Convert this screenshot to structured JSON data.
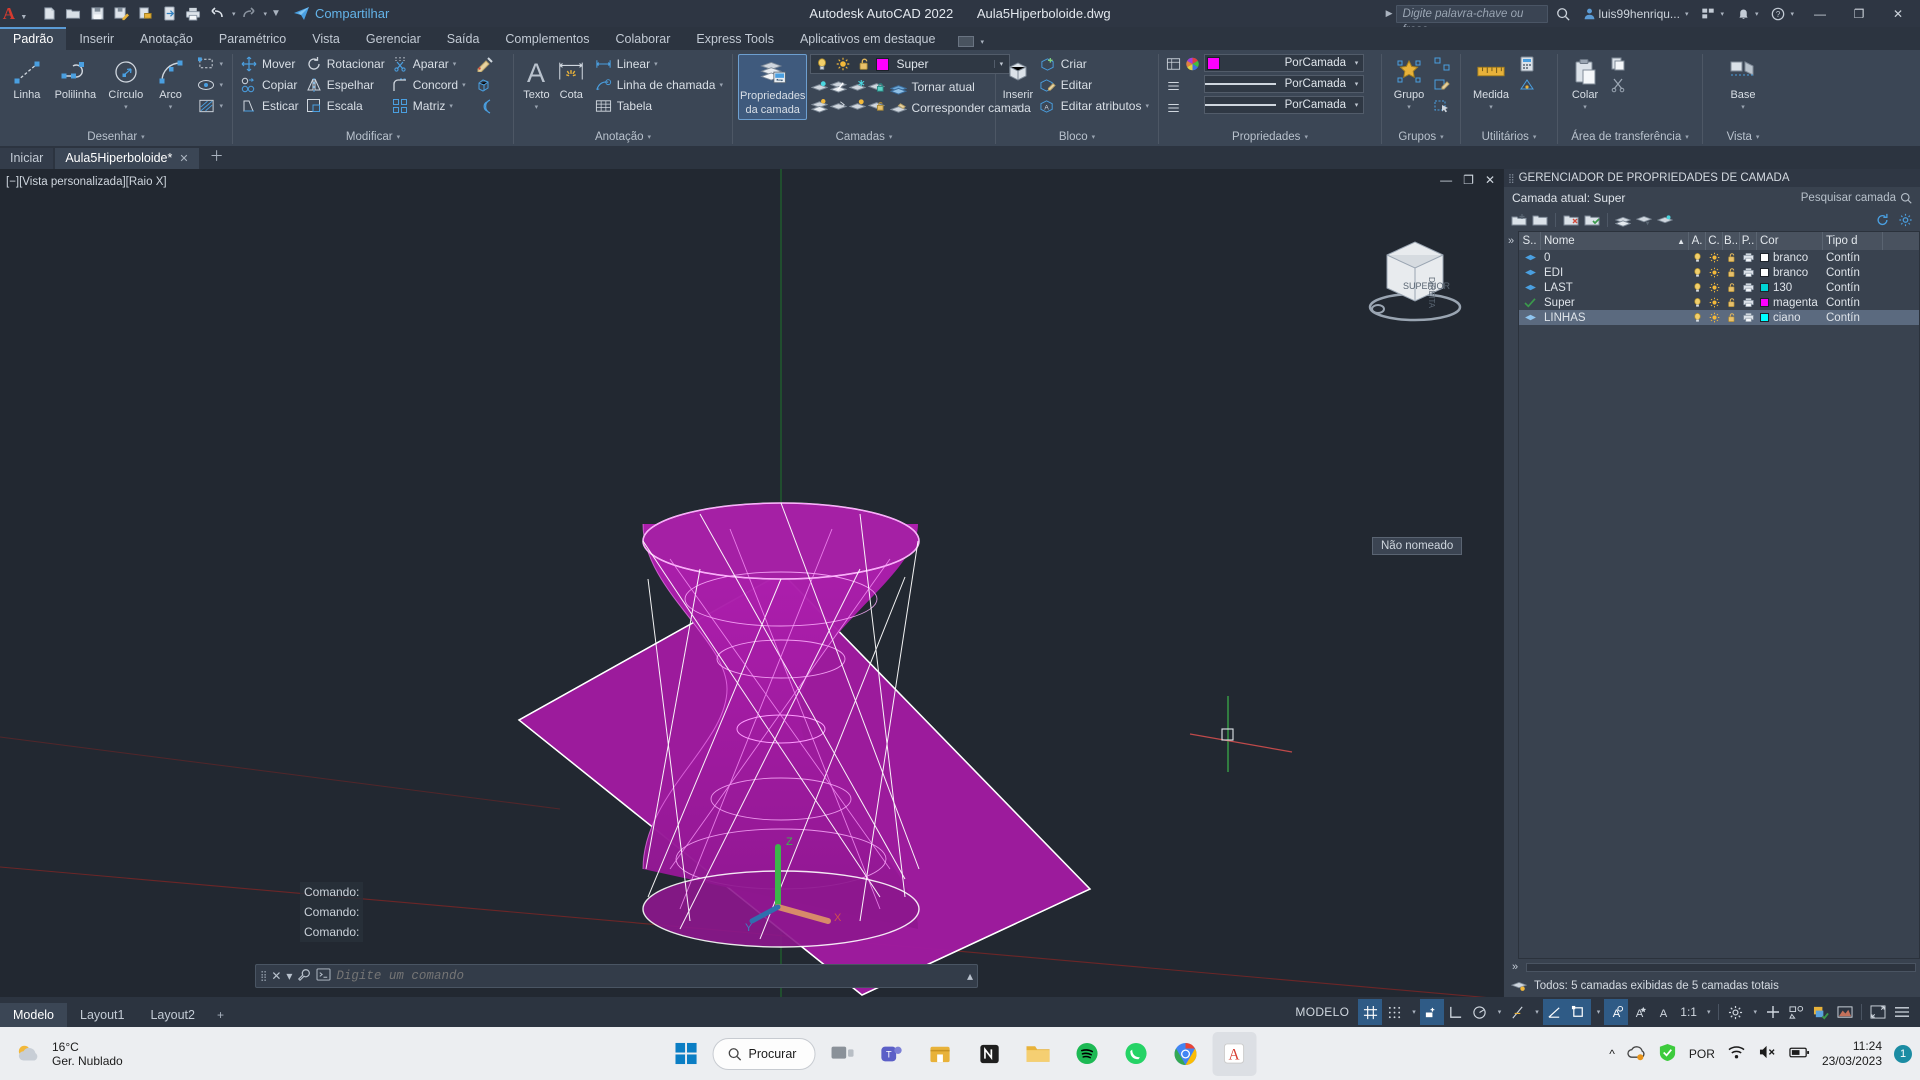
{
  "titlebar": {
    "app_logo": "autocad-a-logo",
    "quick_access": [
      {
        "name": "new-file-icon",
        "label": "Novo"
      },
      {
        "name": "open-folder-icon",
        "label": "Abrir"
      },
      {
        "name": "save-icon",
        "label": "Salvar"
      },
      {
        "name": "save-as-icon",
        "label": "Salvar como"
      },
      {
        "name": "export-icon",
        "label": "Exportar"
      },
      {
        "name": "cloud-sync-icon",
        "label": "Sincronizar"
      },
      {
        "name": "print-icon",
        "label": "Plotar"
      },
      {
        "name": "undo-icon",
        "label": "Desfazer"
      },
      {
        "name": "redo-icon",
        "label": "Refazer"
      },
      {
        "name": "customize-icon",
        "label": "Personalizar"
      }
    ],
    "share_label": "Compartilhar",
    "app_title": "Autodesk AutoCAD 2022",
    "file_name": "Aula5Hiperboloide.dwg",
    "search_placeholder": "Digite palavra-chave ou frase",
    "user_name": "luis99henriqu...",
    "window_buttons": [
      "minimize",
      "maximize",
      "close"
    ]
  },
  "ribbon_tabs": [
    {
      "label": "Padrão",
      "active": true
    },
    {
      "label": "Inserir",
      "active": false
    },
    {
      "label": "Anotação",
      "active": false
    },
    {
      "label": "Paramétrico",
      "active": false
    },
    {
      "label": "Vista",
      "active": false
    },
    {
      "label": "Gerenciar",
      "active": false
    },
    {
      "label": "Saída",
      "active": false
    },
    {
      "label": "Complementos",
      "active": false
    },
    {
      "label": "Colaborar",
      "active": false
    },
    {
      "label": "Express Tools",
      "active": false
    },
    {
      "label": "Aplicativos em destaque",
      "active": false
    }
  ],
  "ribbon": {
    "desenhar": {
      "title": "Desenhar",
      "big_buttons": [
        {
          "label": "Linha",
          "icon": "line-icon"
        },
        {
          "label": "Polilinha",
          "icon": "polyline-icon"
        },
        {
          "label": "Círculo",
          "icon": "circle-icon",
          "dropdown": true
        },
        {
          "label": "Arco",
          "icon": "arc-icon",
          "dropdown": true
        }
      ],
      "small_icons": [
        {
          "name": "rectangle-icon"
        },
        {
          "name": "revcloud-icon"
        },
        {
          "name": "hatch-icon"
        }
      ]
    },
    "modificar": {
      "title": "Modificar",
      "items": [
        {
          "label": "Mover",
          "icon": "move-icon"
        },
        {
          "label": "Rotacionar",
          "icon": "rotate-icon"
        },
        {
          "label": "Aparar",
          "icon": "trim-icon",
          "dropdown": true
        },
        {
          "label": "Copiar",
          "icon": "copy-icon"
        },
        {
          "label": "Espelhar",
          "icon": "mirror-icon"
        },
        {
          "label": "Concord",
          "icon": "fillet-icon",
          "dropdown": true
        },
        {
          "label": "Esticar",
          "icon": "stretch-icon"
        },
        {
          "label": "Escala",
          "icon": "scale-icon"
        },
        {
          "label": "Matriz",
          "icon": "array-icon",
          "dropdown": true
        }
      ],
      "right_icons": [
        {
          "name": "match-properties-icon"
        },
        {
          "name": "explode-icon"
        },
        {
          "name": "offset-icon"
        }
      ]
    },
    "anotacao": {
      "title": "Anotação",
      "big_buttons": [
        {
          "label": "Texto",
          "icon": "text-icon",
          "dropdown": true
        },
        {
          "label": "Cota",
          "icon": "dimension-icon"
        }
      ],
      "items": [
        {
          "label": "Linear",
          "icon": "linear-dim-icon",
          "dropdown": true
        },
        {
          "label": "Linha de chamada",
          "icon": "leader-icon",
          "dropdown": true
        },
        {
          "label": "Tabela",
          "icon": "table-icon"
        }
      ]
    },
    "camadas": {
      "title": "Camadas",
      "big_button": {
        "label1": "Propriedades",
        "label2": "da camada",
        "icon": "layer-properties-icon",
        "active": true
      },
      "current_layer": {
        "name": "Super",
        "color": "#ff00ff"
      },
      "state_icons": [
        "lightbulb-on-icon",
        "sun-icon",
        "unlock-icon"
      ],
      "row_icons": [
        [
          "layer-isolate-icon",
          "layer-off-icon",
          "layer-freeze-icon",
          "layer-lock-icon"
        ],
        [
          "layer-unisolate-icon",
          "layer-on-icon",
          "layer-thaw-icon",
          "layer-unlock-icon"
        ]
      ],
      "items": [
        {
          "label": "Tornar atual",
          "icon": "make-current-icon"
        },
        {
          "label": "Corresponder camada",
          "icon": "match-layer-icon"
        }
      ]
    },
    "bloco": {
      "title": "Bloco",
      "big_button": {
        "label": "Inserir",
        "icon": "insert-block-icon",
        "dropdown": true
      },
      "items": [
        {
          "label": "Criar",
          "icon": "create-block-icon"
        },
        {
          "label": "Editar",
          "icon": "edit-block-icon"
        },
        {
          "label": "Editar atributos",
          "icon": "edit-attributes-icon",
          "dropdown": true
        }
      ]
    },
    "propriedades": {
      "title": "Propriedades",
      "combos": [
        {
          "kind": "color",
          "value": "PorCamada",
          "swatch": "#ff00ff"
        },
        {
          "kind": "linetype",
          "value": "PorCamada"
        },
        {
          "kind": "lineweight",
          "value": "PorCamada"
        }
      ],
      "icons": [
        "property-list-icon",
        "color-wheel-icon",
        "list-icon",
        "list-icon2"
      ]
    },
    "grupos": {
      "title": "Grupos",
      "big_button": {
        "label": "Grupo",
        "icon": "group-icon",
        "dropdown": true
      },
      "small_icons": [
        "ungroup-icon",
        "group-edit-icon",
        "group-select-icon"
      ]
    },
    "utilitarios": {
      "title": "Utilitários",
      "big_button": {
        "label": "Medida",
        "icon": "measure-icon",
        "dropdown": true
      },
      "small_icons": [
        "quick-calc-icon",
        "id-point-icon"
      ]
    },
    "area_transferencia": {
      "title": "Área de transferência",
      "big_button": {
        "label": "Colar",
        "icon": "paste-icon",
        "dropdown": true
      },
      "small_icons": [
        "copy-clip-icon",
        "cut-clip-icon"
      ]
    },
    "vista": {
      "title": "Vista",
      "big_button": {
        "label": "Base",
        "icon": "base-view-icon",
        "dropdown": true
      }
    }
  },
  "drawing_tabs": [
    {
      "label": "Iniciar",
      "active": false,
      "closable": false
    },
    {
      "label": "Aula5Hiperboloide*",
      "active": true,
      "closable": true
    }
  ],
  "canvas": {
    "viewport_label": "[−][Vista personalizada][Raio X]",
    "viewcube_label": "SUPERIOR",
    "viewcube_side_label": "DIREITA",
    "named_view": "Não nomeado",
    "controls": [
      "minimize-viewport",
      "maximize-viewport",
      "close-viewport"
    ],
    "model_colors": {
      "surface": "#a81ca8",
      "wireframe": "#ffffff",
      "magenta_lines": "#ff6cff",
      "grid_axis_green": "#00a000",
      "grid_axis_red": "#a03030",
      "background": "#222831"
    },
    "command_history": [
      "Comando:",
      "Comando:",
      "Comando:"
    ],
    "command_placeholder": "Digite um comando"
  },
  "layer_manager": {
    "title": "GERENCIADOR DE PROPRIEDADES DE CAMADA",
    "current_layer_label": "Camada atual: Super",
    "search_placeholder": "Pesquisar camada",
    "toolbar_icons": [
      "new-layer-icon",
      "new-layer-vp-icon",
      "delete-layer-icon",
      "set-current-icon",
      "layer-states-icon",
      "filter-icon",
      "refresh-icon",
      "settings-icon"
    ],
    "columns": [
      "S..",
      "Nome",
      "A.",
      "C.",
      "B..",
      "P..",
      "Cor",
      "Tipo d"
    ],
    "rows": [
      {
        "status": "layer-icon",
        "name": "0",
        "on": "lightbulb-on-icon",
        "freeze": "sun-icon",
        "lock": "lock-open-icon",
        "plot": "plot-icon",
        "color_name": "branco",
        "color": "#ffffff",
        "linetype": "Contín",
        "selected": false,
        "current": false
      },
      {
        "status": "layer-icon",
        "name": "EDI",
        "on": "lightbulb-on-icon",
        "freeze": "sun-icon",
        "lock": "lock-open-icon",
        "plot": "plot-icon",
        "color_name": "branco",
        "color": "#ffffff",
        "linetype": "Contín",
        "selected": false,
        "current": false
      },
      {
        "status": "layer-icon",
        "name": "LAST",
        "on": "lightbulb-on-icon",
        "freeze": "sun-icon",
        "lock": "lock-open-icon",
        "plot": "plot-icon",
        "color_name": "130",
        "color": "#00d4d4",
        "linetype": "Contín",
        "selected": false,
        "current": false
      },
      {
        "status": "check-icon",
        "name": "Super",
        "on": "lightbulb-on-icon",
        "freeze": "sun-icon",
        "lock": "lock-open-icon",
        "plot": "plot-icon",
        "color_name": "magenta",
        "color": "#ff00ff",
        "linetype": "Contín",
        "selected": false,
        "current": true
      },
      {
        "status": "layer-icon",
        "name": "LINHAS",
        "on": "lightbulb-on-icon",
        "freeze": "sun-icon",
        "lock": "lock-open-icon",
        "plot": "plot-icon",
        "color_name": "ciano",
        "color": "#00ffff",
        "linetype": "Contín",
        "selected": true,
        "current": false
      }
    ],
    "status_text": "Todos: 5 camadas exibidas de 5 camadas totais",
    "expander": "»"
  },
  "status_bar": {
    "layout_tabs": [
      {
        "label": "Modelo",
        "active": true
      },
      {
        "label": "Layout1",
        "active": false
      },
      {
        "label": "Layout2",
        "active": false
      }
    ],
    "layout_add": "+",
    "space_label": "MODELO",
    "scale": "1:1",
    "toggles": [
      {
        "name": "grid-display-icon",
        "on": true
      },
      {
        "name": "snap-mode-icon",
        "on": false,
        "dropdown": true
      },
      {
        "name": "infer-constraints-icon",
        "on": true
      },
      {
        "name": "ortho-mode-icon",
        "on": false
      },
      {
        "name": "polar-tracking-icon",
        "on": false,
        "dropdown": true
      },
      {
        "name": "object-snap-tracking-icon",
        "on": false,
        "dropdown": true
      },
      {
        "name": "object-snap-icon",
        "on": true
      },
      {
        "name": "ucs-icon",
        "on": true,
        "dropdown": true
      },
      {
        "name": "annotation-visibility-icon",
        "on": true
      },
      {
        "name": "autoscale-icon",
        "on": false
      },
      {
        "name": "annotation-scale-icon",
        "on": false
      },
      {
        "name": "workspace-icon",
        "on": false,
        "dropdown": true
      },
      {
        "name": "hardware-accel-icon",
        "on": false
      },
      {
        "name": "isolate-objects-icon",
        "on": false
      },
      {
        "name": "clean-screen-icon",
        "on": false
      },
      {
        "name": "customization-icon",
        "on": false
      }
    ]
  },
  "taskbar": {
    "weather": {
      "temp": "16°C",
      "desc": "Ger. Nublado",
      "icon": "cloud-icon"
    },
    "start_icon": "windows-start-icon",
    "search_label": "Procurar",
    "apps": [
      {
        "name": "task-view-icon"
      },
      {
        "name": "teams-icon"
      },
      {
        "name": "store-icon"
      },
      {
        "name": "notion-icon"
      },
      {
        "name": "file-explorer-icon"
      },
      {
        "name": "spotify-icon"
      },
      {
        "name": "whatsapp-icon"
      },
      {
        "name": "chrome-icon"
      },
      {
        "name": "autocad-icon",
        "active": true
      }
    ],
    "tray": {
      "overflow": "^",
      "icons": [
        "onedrive-icon",
        "defender-icon"
      ],
      "language": "POR",
      "network": "wifi-icon",
      "volume": "volume-muted-icon",
      "battery": "battery-icon",
      "time": "11:24",
      "date": "23/03/2023",
      "notification_count": "1"
    }
  }
}
